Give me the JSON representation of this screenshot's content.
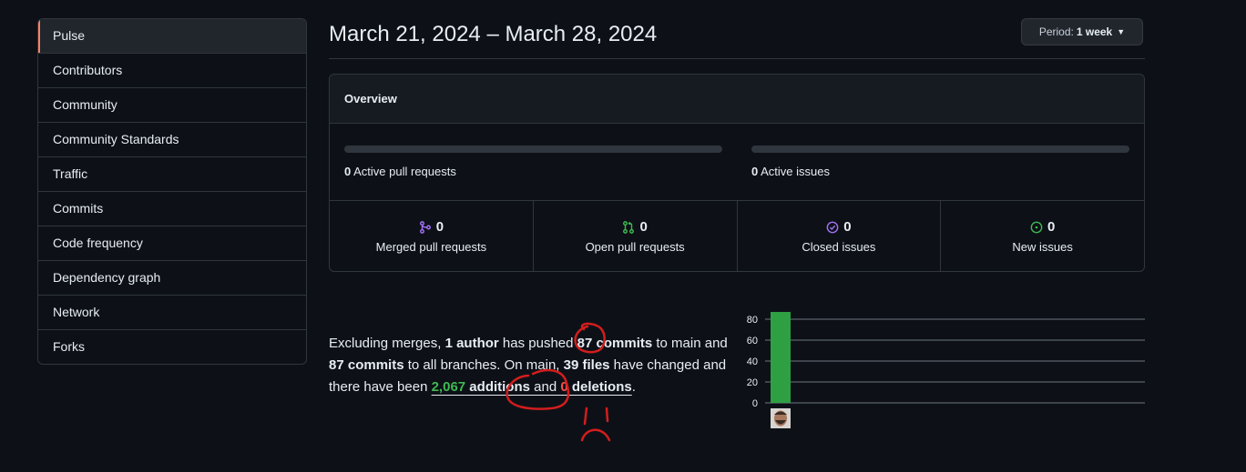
{
  "sidebar": {
    "items": [
      {
        "label": "Pulse",
        "selected": true
      },
      {
        "label": "Contributors"
      },
      {
        "label": "Community"
      },
      {
        "label": "Community Standards"
      },
      {
        "label": "Traffic"
      },
      {
        "label": "Commits"
      },
      {
        "label": "Code frequency"
      },
      {
        "label": "Dependency graph"
      },
      {
        "label": "Network"
      },
      {
        "label": "Forks"
      }
    ]
  },
  "header": {
    "date_range": "March 21, 2024 – March 28, 2024",
    "period_label": "Period:",
    "period_value": "1 week"
  },
  "overview": {
    "title": "Overview",
    "active_prs": {
      "count": "0",
      "label": "Active pull requests"
    },
    "active_issues": {
      "count": "0",
      "label": "Active issues"
    },
    "stats": [
      {
        "count": "0",
        "label": "Merged pull requests",
        "icon": "merge-icon",
        "color": "#a371f7"
      },
      {
        "count": "0",
        "label": "Open pull requests",
        "icon": "pull-request-icon",
        "color": "#3fb950"
      },
      {
        "count": "0",
        "label": "Closed issues",
        "icon": "issue-closed-icon",
        "color": "#a371f7"
      },
      {
        "count": "0",
        "label": "New issues",
        "icon": "issue-opened-icon",
        "color": "#3fb950"
      }
    ]
  },
  "summary": {
    "t1": "Excluding merges, ",
    "authors": "1 author",
    "t2": " has pushed ",
    "commits_main": "87 commits",
    "t3": " to main and ",
    "commits_all": "87 commits",
    "t4": " to all branches. On main, ",
    "files": "39 files",
    "t5": " have changed and there have been ",
    "additions_num": "2,067",
    "additions_word": " additions",
    "t6": " and ",
    "deletions_num": "0",
    "deletions_word": " deletions",
    "t7": "."
  },
  "chart_data": {
    "type": "bar",
    "categories": [
      "contributor-1"
    ],
    "values": [
      87
    ],
    "ylim": [
      0,
      87
    ],
    "yticks": [
      "80",
      "60",
      "40",
      "20",
      "0"
    ],
    "bar_color": "#2ea043"
  },
  "annotations": {
    "color": "#d31d1d"
  }
}
